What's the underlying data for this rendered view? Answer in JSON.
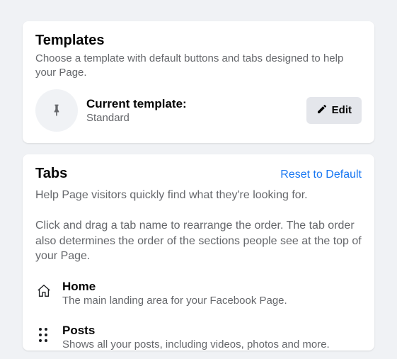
{
  "templates": {
    "title": "Templates",
    "subtitle": "Choose a template with default buttons and tabs designed to help your Page.",
    "currentLabel": "Current template:",
    "currentValue": "Standard",
    "editLabel": "Edit"
  },
  "tabs": {
    "title": "Tabs",
    "resetLabel": "Reset to Default",
    "description": "Help Page visitors quickly find what they're looking for.",
    "instruction": "Click and drag a tab name to rearrange the order. The tab order also determines the order of the sections people see at the top of your Page.",
    "items": [
      {
        "name": "Home",
        "description": "The main landing area for your Facebook Page."
      },
      {
        "name": "Posts",
        "description": "Shows all your posts, including videos, photos and more."
      }
    ]
  }
}
